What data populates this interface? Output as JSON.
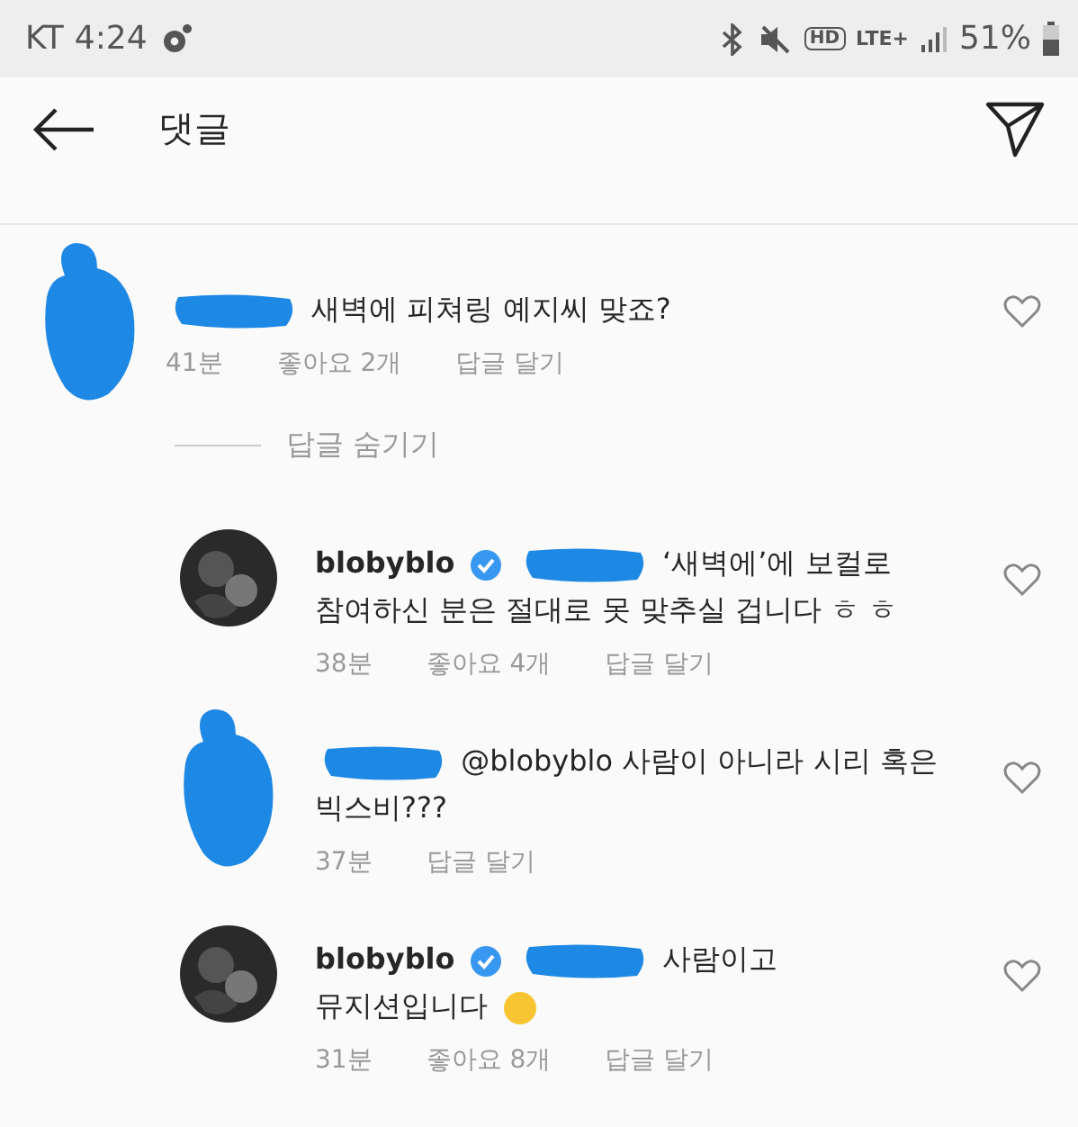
{
  "status_bar": {
    "carrier": "KT",
    "time": "4:24",
    "hd": "HD",
    "network": "LTE+",
    "battery": "51%"
  },
  "header": {
    "title": "댓글"
  },
  "comments": [
    {
      "kind": "comment",
      "avatar_hidden": true,
      "verified": false,
      "redacted": true,
      "lines": [
        "새벽에 피쳐링 예지씨 맞죠?"
      ],
      "time": "41분",
      "likes": "좋아요 2개",
      "reply": "답글 달기",
      "liked": false
    },
    {
      "kind": "toggle",
      "label": "답글 숨기기"
    },
    {
      "kind": "reply",
      "avatar_hidden": false,
      "username": "blobyblo",
      "verified": true,
      "redacted": true,
      "lines": [
        "‘새벽에’에 보컬로",
        "참여하신 분은 절대로 못 맞추실 겁니다 ㅎ ㅎ"
      ],
      "time": "38분",
      "likes": "좋아요 4개",
      "reply": "답글 달기",
      "liked": false
    },
    {
      "kind": "reply",
      "avatar_hidden": true,
      "verified": false,
      "redacted": true,
      "lines": [
        "@blobyblo 사람이 아니라 시리 혹은",
        "빅스비???"
      ],
      "time": "37분",
      "reply": "답글 달기",
      "liked": false
    },
    {
      "kind": "reply",
      "avatar_hidden": false,
      "username": "blobyblo",
      "verified": true,
      "redacted": true,
      "lines": [
        "사람이고",
        "뮤지션입니다"
      ],
      "emoji": true,
      "time": "31분",
      "likes": "좋아요 8개",
      "reply": "답글 달기",
      "liked": false
    }
  ]
}
